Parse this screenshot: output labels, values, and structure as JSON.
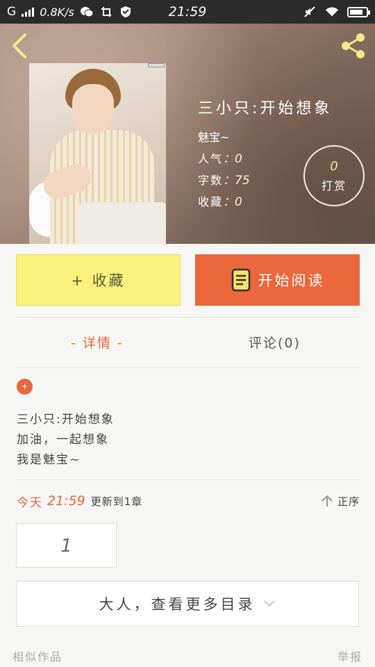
{
  "status_bar": {
    "carrier": "G",
    "speed": "0.8K/s",
    "time": "21:59"
  },
  "book": {
    "title": "三小只:开始想象",
    "author": "魅宝~",
    "popularity_label": "人气",
    "popularity_value": "0",
    "word_count_label": "字数",
    "word_count_value": "75",
    "favorites_label": "收藏",
    "favorites_value": "0",
    "reward_count": "0",
    "reward_label": "打赏"
  },
  "actions": {
    "collect_label": "+ 收藏",
    "read_label": "开始阅读"
  },
  "tabs": {
    "details": "- 详情 -",
    "comments": "评论(0)"
  },
  "intro": {
    "badge": "+",
    "lines": [
      "三小只:开始想象",
      "加油，一起想象",
      "我是魅宝~"
    ]
  },
  "update": {
    "today": "今天",
    "time": "21:59",
    "text": "更新到1章",
    "order_label": "正序"
  },
  "pagination": {
    "page": "1"
  },
  "more_catalog": {
    "label": "大人，查看更多目录"
  },
  "footer": {
    "similar": "相似作品",
    "report": "举报"
  },
  "colors": {
    "accent": "#e9673b",
    "collect_bg": "#faf27c",
    "reward_number": "#f6e78a"
  }
}
